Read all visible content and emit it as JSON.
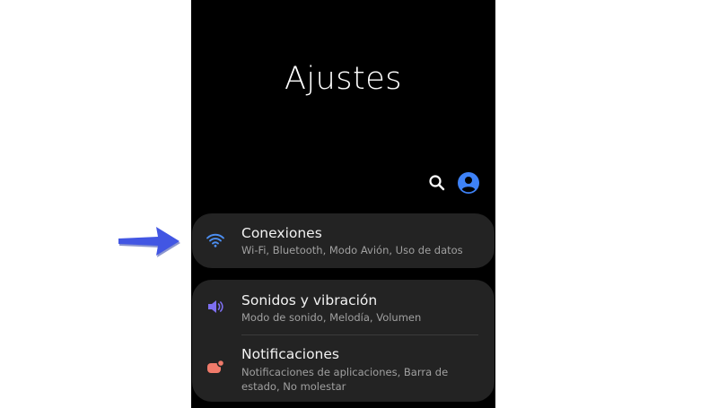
{
  "header": {
    "title": "Ajustes",
    "search_icon": "search-icon",
    "profile_icon": "account-icon"
  },
  "colors": {
    "accent_blue": "#3e82f7",
    "arrow_blue": "#4256e3",
    "wifi_icon": "#4c8ef0",
    "sound_icon": "#7e6ff0",
    "notification_icon": "#f07a6a"
  },
  "menu": {
    "connections": {
      "label": "Conexiones",
      "description": "Wi-Fi, Bluetooth, Modo Avión, Uso de datos",
      "icon": "wifi-icon"
    },
    "sounds": {
      "label": "Sonidos y vibración",
      "description": "Modo de sonido, Melodía, Volumen",
      "icon": "speaker-icon"
    },
    "notifications": {
      "label": "Notificaciones",
      "description": "Notificaciones de aplicaciones, Barra de estado, No molestar",
      "icon": "notification-badge-icon"
    }
  },
  "annotation": {
    "icon": "arrow-right-icon"
  }
}
